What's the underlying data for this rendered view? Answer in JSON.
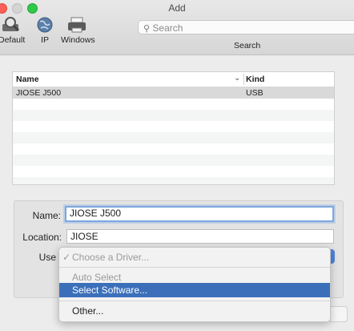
{
  "window": {
    "title": "Add"
  },
  "toolbar": {
    "tabs": [
      {
        "label": "Default",
        "icon": "default-printer-icon"
      },
      {
        "label": "IP",
        "icon": "globe-icon"
      },
      {
        "label": "Windows",
        "icon": "windows-printer-icon"
      }
    ],
    "search": {
      "placeholder": "Search",
      "label": "Search"
    }
  },
  "printer_list": {
    "columns": [
      "Name",
      "Kind"
    ],
    "rows": [
      {
        "name": "JIOSE J500",
        "kind": "USB",
        "selected": true
      }
    ]
  },
  "form": {
    "name_label": "Name:",
    "name_value": "JIOSE J500",
    "location_label": "Location:",
    "location_value": "JIOSE",
    "use_label": "Use"
  },
  "driver_menu": {
    "items": [
      {
        "label": "Choose a Driver...",
        "checked": true,
        "disabled": true
      },
      {
        "label": "Auto Select",
        "disabled": true
      },
      {
        "label": "Select Software...",
        "highlighted": true
      },
      {
        "label": "Other..."
      }
    ]
  },
  "colors": {
    "highlight": "#3b6fba",
    "close": "#fc5f57",
    "zoom": "#31c748"
  }
}
